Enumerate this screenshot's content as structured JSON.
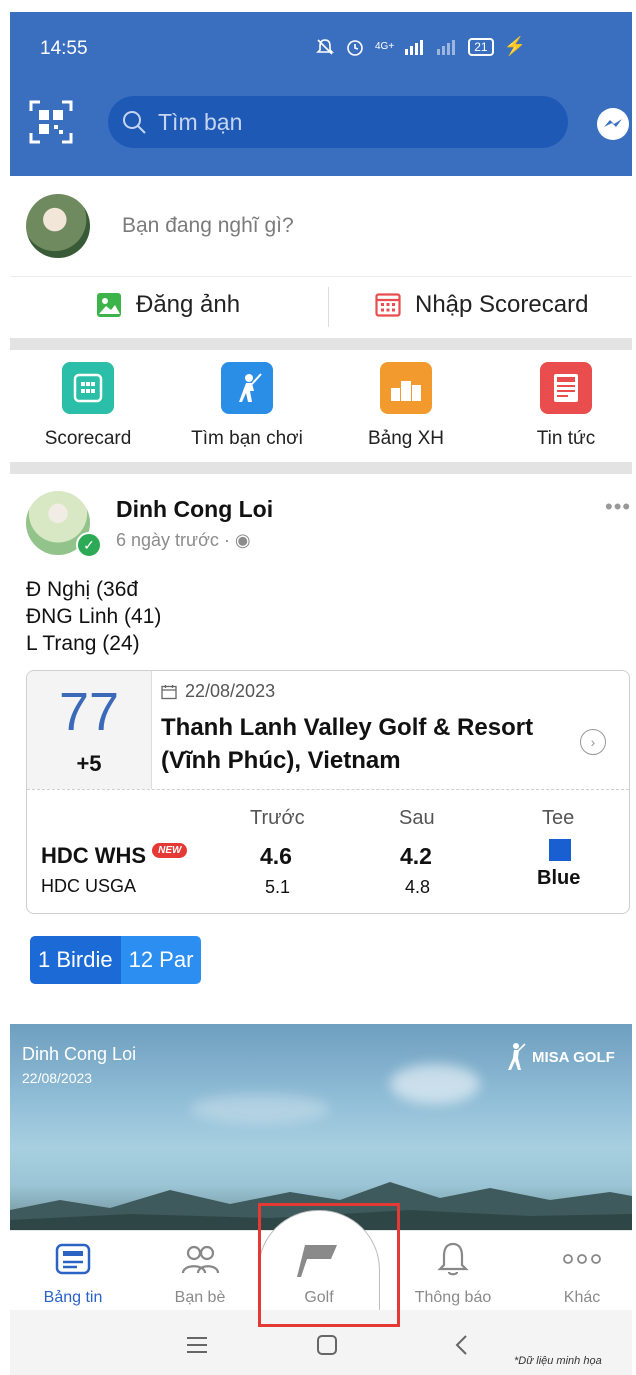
{
  "status_bar": {
    "time": "14:55",
    "network": "4G+",
    "battery": "21"
  },
  "header": {
    "search_placeholder": "Tìm bạn"
  },
  "composer": {
    "prompt": "Bạn đang nghĩ gì?"
  },
  "actions": {
    "post_photo": "Đăng ảnh",
    "enter_scorecard": "Nhập Scorecard"
  },
  "shortcuts": [
    {
      "label": "Scorecard",
      "icon": "scorecard-icon",
      "color": "#2bbfa9"
    },
    {
      "label": "Tìm bạn chơi",
      "icon": "golfer-icon",
      "color": "#2a8ee6"
    },
    {
      "label": "Bảng XH",
      "icon": "podium-icon",
      "color": "#f39a2e"
    },
    {
      "label": "Tin tức",
      "icon": "news-icon",
      "color": "#e94d4d"
    }
  ],
  "post": {
    "author": "Dinh Cong Loi",
    "time": "6 ngày trước",
    "lines": [
      "Đ Nghị (36đ",
      "ĐNG Linh (41)",
      "L Trang (24)"
    ],
    "card": {
      "score": "77",
      "over_par": "+5",
      "date": "22/08/2023",
      "course": "Thanh Lanh Valley Golf & Resort (Vĩnh Phúc), Vietnam",
      "col_before": "Trước",
      "col_after": "Sau",
      "col_tee": "Tee",
      "hdc_whs_label": "HDC WHS",
      "new_badge": "NEW",
      "hdc_usga_label": "HDC USGA",
      "whs_before": "4.6",
      "whs_after": "4.2",
      "usga_before": "5.1",
      "usga_after": "4.8",
      "tee_name": "Blue",
      "tee_color": "#1a5fd1"
    },
    "chips": [
      "1 Birdie",
      "12 Par"
    ],
    "photo": {
      "name": "Dinh Cong Loi",
      "date": "22/08/2023",
      "brand": "MISA GOLF"
    }
  },
  "nav": {
    "feed": "Bảng tin",
    "friends": "Bạn bè",
    "golf": "Golf",
    "notifications": "Thông báo",
    "more": "Khác"
  },
  "disclaimer": "*Dữ liệu minh họa",
  "colors": {
    "brand_blue": "#3a6fc0",
    "accent_blue": "#2b63c4",
    "highlight_red": "#e53935"
  }
}
